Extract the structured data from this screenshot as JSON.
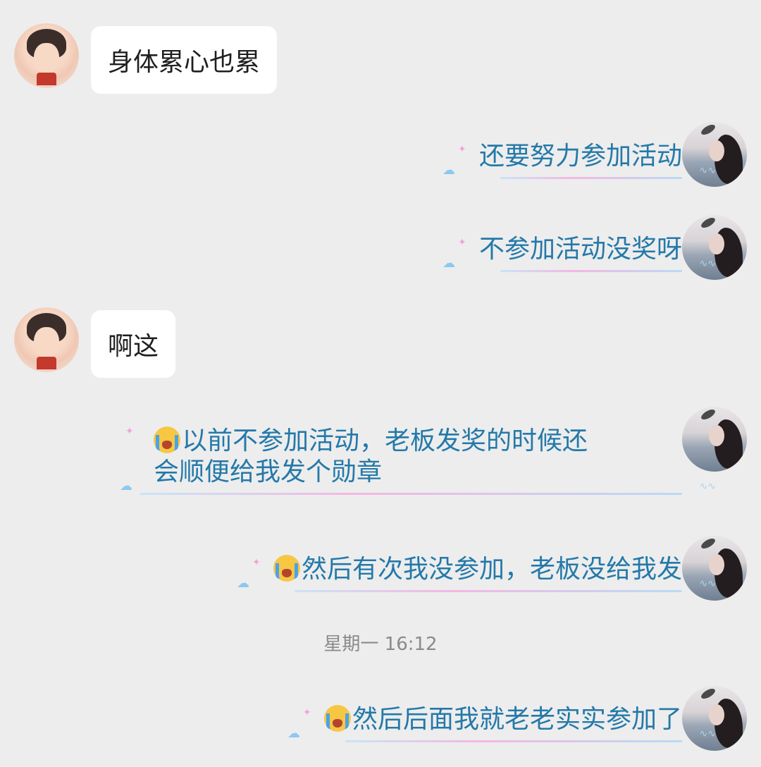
{
  "messages": [
    {
      "side": "left",
      "text": "身体累心也累"
    },
    {
      "side": "right",
      "text": "还要努力参加活动"
    },
    {
      "side": "right",
      "text": "不参加活动没奖呀"
    },
    {
      "side": "left",
      "text": "啊这"
    },
    {
      "side": "right",
      "emoji": "loudly-crying-face",
      "line1": "以前不参加活动，老板发奖的时候还",
      "line2": "会顺便给我发个勋章"
    },
    {
      "side": "right",
      "emoji": "loudly-crying-face",
      "text": "然后有次我没参加，老板没给我发"
    },
    {
      "side": "right",
      "emoji": "loudly-crying-face",
      "text": "然后后面我就老老实实参加了"
    }
  ],
  "timestamp": "星期一 16:12",
  "colors": {
    "background": "#ededed",
    "left_bubble": "#ffffff",
    "right_text": "#2479a9",
    "timestamp": "#8a8a8a"
  }
}
